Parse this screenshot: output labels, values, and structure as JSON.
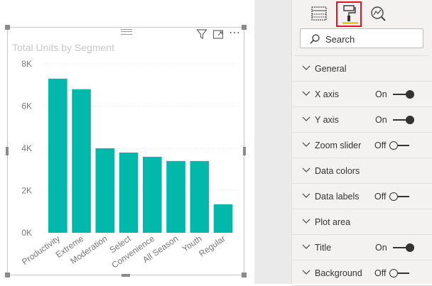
{
  "chart": {
    "title": "Total Units by Segment",
    "bar_color": "#01b8aa"
  },
  "chart_data": {
    "type": "bar",
    "title": "Total Units by Segment",
    "categories": [
      "Productivity",
      "Extreme",
      "Moderation",
      "Select",
      "Convenience",
      "All Season",
      "Youth",
      "Regular"
    ],
    "values": [
      7300,
      6800,
      4000,
      3800,
      3600,
      3400,
      3400,
      1350
    ],
    "yticks": [
      "0K",
      "2K",
      "4K",
      "6K",
      "8K"
    ],
    "ylim": [
      0,
      8000
    ],
    "grid": true,
    "xlabel": "",
    "ylabel": ""
  },
  "visual_header": {
    "icons": [
      "filter-icon",
      "focus-mode-icon",
      "more-options-icon"
    ],
    "more_glyph": "⋯"
  },
  "pane": {
    "tabs": [
      {
        "icon": "fields-icon",
        "selected": false
      },
      {
        "icon": "format-paint-roller-icon",
        "selected": true
      },
      {
        "icon": "analytics-icon",
        "selected": false
      }
    ],
    "accent_color": "#f2c811",
    "highlight_color": "#e81123",
    "search": {
      "placeholder": "Search"
    },
    "sections": [
      {
        "label": "General"
      },
      {
        "label": "X axis",
        "state": "On"
      },
      {
        "label": "Y axis",
        "state": "On"
      },
      {
        "label": "Zoom slider",
        "state": "Off"
      },
      {
        "label": "Data colors"
      },
      {
        "label": "Data labels",
        "state": "Off"
      },
      {
        "label": "Plot area"
      },
      {
        "label": "Title",
        "state": "On"
      },
      {
        "label": "Background",
        "state": "Off"
      }
    ]
  }
}
